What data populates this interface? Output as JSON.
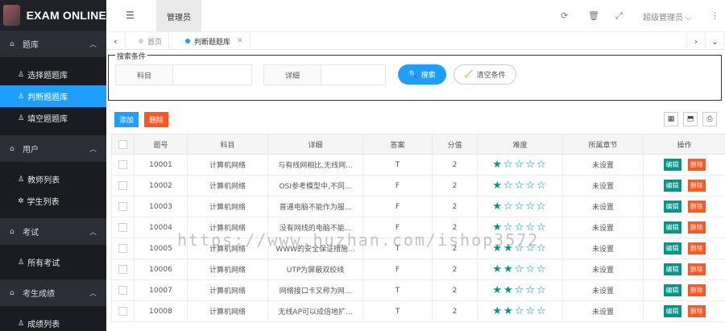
{
  "app": {
    "title": "EXAM ONLINE"
  },
  "sidebar": {
    "groups": [
      {
        "label": "题库",
        "items": [
          "选择题题库",
          "判断题题库",
          "填空题题库"
        ]
      },
      {
        "label": "用户",
        "items": [
          "教师列表",
          "学生列表"
        ]
      },
      {
        "label": "考试",
        "items": [
          "所有考试"
        ]
      },
      {
        "label": "考生成绩",
        "items": [
          "成绩列表"
        ]
      }
    ],
    "active_item": "判断题题库"
  },
  "header": {
    "role_tab": "管理员",
    "user_menu": "超级管理员"
  },
  "tabs": [
    {
      "label": "首页",
      "active": false
    },
    {
      "label": "判断题题库",
      "active": true
    }
  ],
  "search": {
    "legend": "搜索条件",
    "subject_label": "科目",
    "detail_label": "详细",
    "search_button": "搜索",
    "clear_button": "清空条件"
  },
  "toolbar": {
    "add_label": "添加",
    "delete_label": "删除"
  },
  "table": {
    "columns": [
      "题号",
      "科目",
      "详细",
      "答案",
      "分值",
      "难度",
      "所属章节",
      "操作"
    ],
    "rows": [
      {
        "id": "10001",
        "subject": "计算机网络",
        "detail": "与有线网相比,无线网...",
        "answer": "T",
        "score": "2",
        "difficulty": 1,
        "chapter": "未设置"
      },
      {
        "id": "10002",
        "subject": "计算机网络",
        "detail": "OSI参考模型中,不同...",
        "answer": "F",
        "score": "2",
        "difficulty": 1,
        "chapter": "未设置"
      },
      {
        "id": "10003",
        "subject": "计算机网络",
        "detail": "普通电脑不能作为服...",
        "answer": "F",
        "score": "2",
        "difficulty": 1,
        "chapter": "未设置"
      },
      {
        "id": "10004",
        "subject": "计算机网络",
        "detail": "没有网线的电脑不能...",
        "answer": "F",
        "score": "2",
        "difficulty": 1,
        "chapter": "未设置"
      },
      {
        "id": "10005",
        "subject": "计算机网络",
        "detail": "WWW的安全保证措施...",
        "answer": "T",
        "score": "2",
        "difficulty": 2,
        "chapter": "未设置"
      },
      {
        "id": "10006",
        "subject": "计算机网络",
        "detail": "UTP为屏蔽双绞线",
        "answer": "F",
        "score": "2",
        "difficulty": 2,
        "chapter": "未设置"
      },
      {
        "id": "10007",
        "subject": "计算机网络",
        "detail": "网络接口卡又称为网...",
        "answer": "T",
        "score": "2",
        "difficulty": 2,
        "chapter": "未设置"
      },
      {
        "id": "10008",
        "subject": "计算机网络",
        "detail": "无线AP可以成倍地扩...",
        "answer": "T",
        "score": "2",
        "difficulty": 2,
        "chapter": "未设置"
      }
    ],
    "edit_label": "编辑",
    "delete_label": "删除"
  },
  "watermark": "https://www.huzhan.com/ishop3572",
  "colors": {
    "primary": "#1e9fff",
    "danger": "#ff5722",
    "teal": "#009688",
    "sidebar": "#20222a"
  }
}
